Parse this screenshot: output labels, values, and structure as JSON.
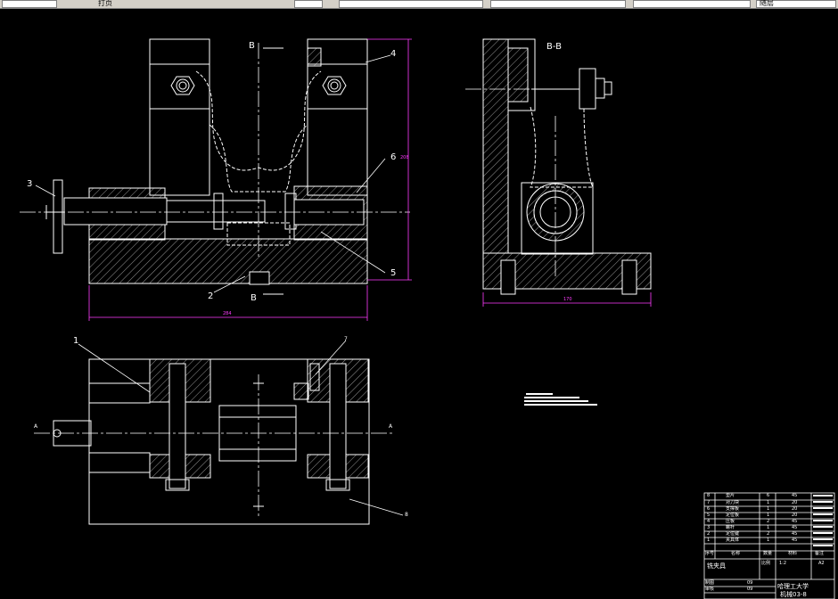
{
  "toolbar": {
    "seg1": "打页",
    "seg2": "",
    "seg3": "",
    "seg4": "",
    "seg5": "",
    "seg6": "随层"
  },
  "drawing": {
    "section_label_top": "B",
    "section_label_bottom": "B",
    "section_view_title": "B-B",
    "section_a_left": "A",
    "section_a_right": "A",
    "part_numbers": {
      "p1": "1",
      "p2": "2",
      "p3": "3",
      "p4": "4",
      "p5": "5",
      "p6": "6",
      "p7": "7",
      "p8": "8"
    },
    "dims": {
      "width_front": "284",
      "height_front": "208",
      "width_side": "170"
    }
  },
  "title_block": {
    "rows": [
      {
        "no": "8",
        "name": "垫片",
        "qty": "6",
        "material": "45"
      },
      {
        "no": "7",
        "name": "对刀块",
        "qty": "1",
        "material": "20"
      },
      {
        "no": "6",
        "name": "支撑板",
        "qty": "1",
        "material": "20"
      },
      {
        "no": "5",
        "name": "定位板",
        "qty": "1",
        "material": "20"
      },
      {
        "no": "4",
        "name": "压板",
        "qty": "2",
        "material": "45"
      },
      {
        "no": "3",
        "name": "螺杆",
        "qty": "1",
        "material": "45"
      },
      {
        "no": "2",
        "name": "定位键",
        "qty": "2",
        "material": "45"
      },
      {
        "no": "1",
        "name": "夹具体",
        "qty": "1",
        "material": "45"
      }
    ],
    "headers": {
      "no": "序号",
      "name": "名称",
      "qty": "数量",
      "material": "材料",
      "note": "备注"
    },
    "drawing_name": "铣夹具",
    "scale_label": "比例",
    "scale": "1:2",
    "sheet_size": "A2",
    "school": "哈理工大学",
    "class": "机械03-8",
    "designer_label": "制图",
    "checker_label": "审核",
    "date1": "09",
    "date2": "09"
  }
}
